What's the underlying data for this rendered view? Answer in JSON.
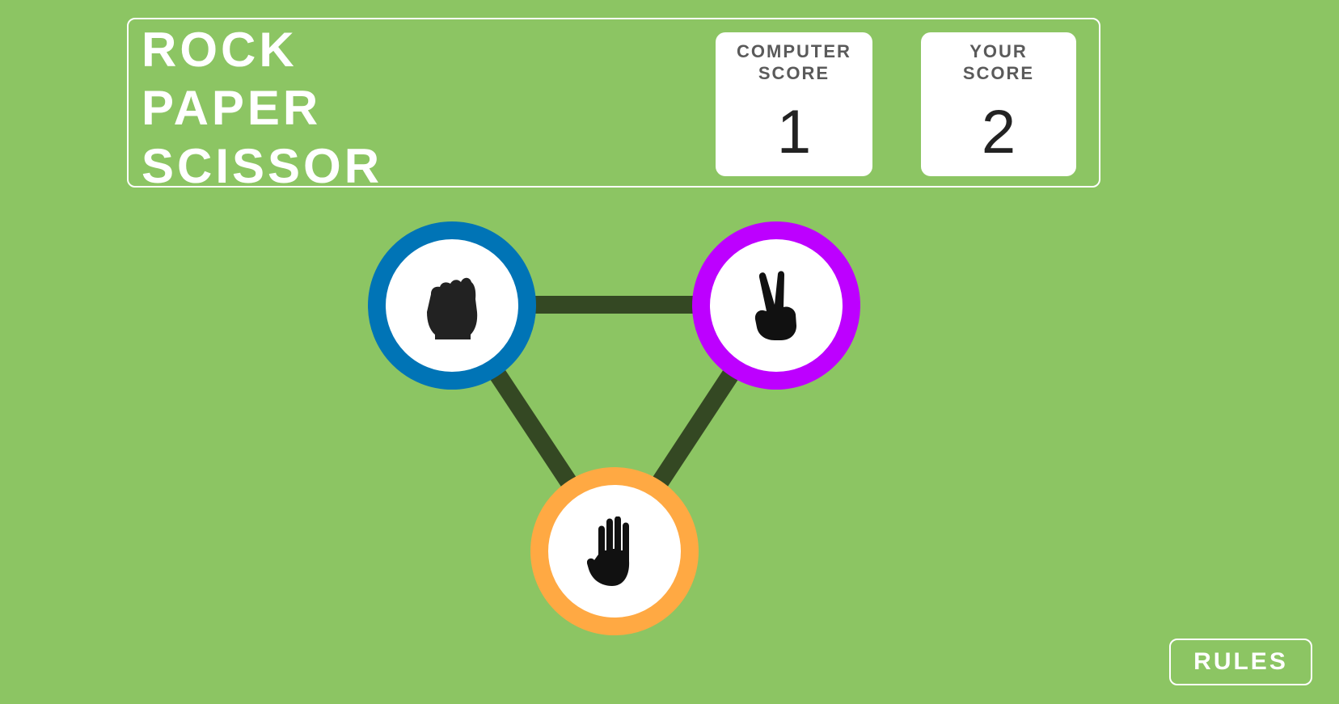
{
  "header": {
    "title_lines": [
      "ROCK",
      "PAPER",
      "SCISSOR"
    ],
    "computer_score": {
      "label_lines": [
        "COMPUTER",
        "SCORE"
      ],
      "value": "1"
    },
    "your_score": {
      "label_lines": [
        "YOUR",
        "SCORE"
      ],
      "value": "2"
    }
  },
  "game": {
    "choices": [
      {
        "name": "rock",
        "icon": "fist-icon",
        "ring_color": "#0074b6"
      },
      {
        "name": "scissor",
        "icon": "victory-hand-icon",
        "ring_color": "#bd00ff"
      },
      {
        "name": "paper",
        "icon": "open-hand-icon",
        "ring_color": "#ffa943"
      }
    ],
    "connector_color": "#344823"
  },
  "footer": {
    "rules_label": "RULES"
  },
  "colors": {
    "background": "#8cc563",
    "text": "#ffffff"
  }
}
